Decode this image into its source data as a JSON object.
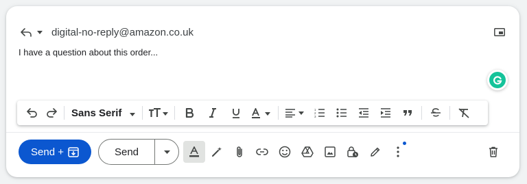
{
  "header": {
    "recipient": "digital-no-reply@amazon.co.uk"
  },
  "body": {
    "text": "I have a question about this order..."
  },
  "format_bar": {
    "font_family": "Sans Serif",
    "icons": [
      "undo-icon",
      "redo-icon",
      "text-size-icon",
      "bold-icon",
      "italic-icon",
      "underline-icon",
      "text-color-icon",
      "align-icon",
      "numbered-list-icon",
      "bulleted-list-icon",
      "indent-less-icon",
      "indent-more-icon",
      "quote-icon",
      "strikethrough-icon",
      "remove-formatting-icon"
    ]
  },
  "bottom_bar": {
    "send_schedule_label": "Send +",
    "send_label": "Send",
    "icons": [
      "formatting-options-icon",
      "magic-write-icon",
      "attach-icon",
      "link-icon",
      "emoji-icon",
      "drive-icon",
      "photo-icon",
      "confidential-mode-icon",
      "signature-icon",
      "more-options-icon",
      "discard-icon"
    ]
  },
  "colors": {
    "primary": "#0b57d0",
    "grammarly": "#15c39a"
  }
}
